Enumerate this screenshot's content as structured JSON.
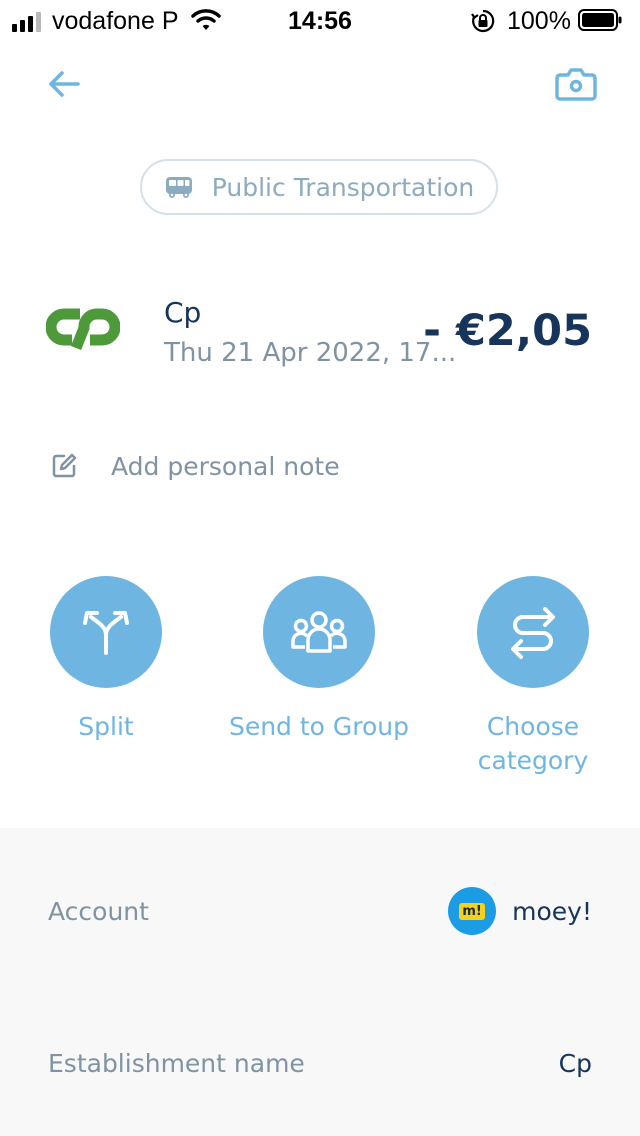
{
  "status_bar": {
    "carrier": "vodafone P",
    "time": "14:56",
    "battery": "100%"
  },
  "header": {
    "back_icon": "arrow-left-icon",
    "camera_icon": "camera-icon"
  },
  "category": {
    "icon": "bus-icon",
    "label": "Public Transportation"
  },
  "transaction": {
    "merchant_logo": "cp-logo",
    "merchant": "Cp",
    "date": "Thu 21 Apr 2022, 17...",
    "amount": "- €2,05"
  },
  "note": {
    "icon": "edit-icon",
    "label": "Add personal note"
  },
  "actions": [
    {
      "icon": "split-arrows-icon",
      "label": "Split"
    },
    {
      "icon": "group-icon",
      "label": "Send to Group"
    },
    {
      "icon": "swap-arrows-icon",
      "label": "Choose category"
    }
  ],
  "details": {
    "account_label": "Account",
    "account_logo_text": "m!",
    "account_value": "moey!",
    "establishment_label": "Establishment name",
    "establishment_value": "Cp"
  },
  "colors": {
    "accent": "#6eb6e1",
    "text_dark": "#17345a",
    "text_muted": "#7f93a4",
    "cp_green": "#4e9a3b",
    "moey_blue": "#1d9ce6",
    "moey_yellow": "#f2d21b"
  }
}
